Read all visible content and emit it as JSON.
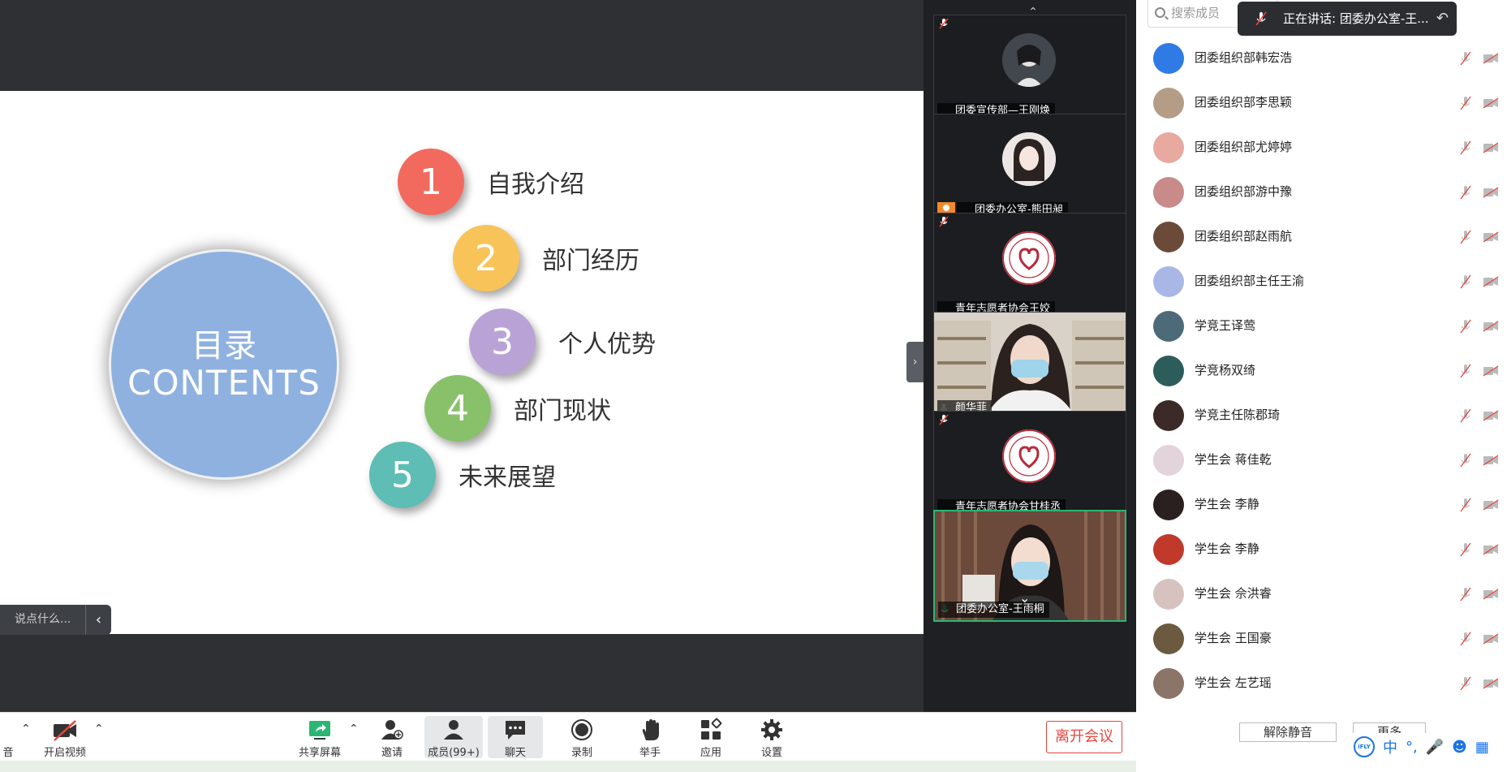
{
  "slide": {
    "center_line1": "目录",
    "center_line2": "CONTENTS",
    "items": [
      {
        "num": "1",
        "label": "自我介绍",
        "color": "#f26a5e"
      },
      {
        "num": "2",
        "label": "部门经历",
        "color": "#f8c45a"
      },
      {
        "num": "3",
        "label": "个人优势",
        "color": "#b9a3d6"
      },
      {
        "num": "4",
        "label": "部门现状",
        "color": "#88c16a"
      },
      {
        "num": "5",
        "label": "未来展望",
        "color": "#5ebdb5"
      }
    ]
  },
  "say_box": {
    "placeholder": "说点什么..."
  },
  "strip": {
    "tiles": [
      {
        "name": "团委宣传部—王刚焕"
      },
      {
        "name": "团委办公室-熊田昶"
      },
      {
        "name": "青年志愿者协会王姣"
      },
      {
        "name": "颜华菲"
      },
      {
        "name": "青年志愿者协会甘桂丞"
      },
      {
        "name": "团委办公室-王雨桐"
      }
    ]
  },
  "panel": {
    "search_placeholder": "搜索成员",
    "speaking": "正在讲话: 团委办公室-王...",
    "members": [
      {
        "name": "团委组织部韩宏浩",
        "color": "#2f7ae5"
      },
      {
        "name": "团委组织部李思颖",
        "color": "#b59c86"
      },
      {
        "name": "团委组织部尤婷婷",
        "color": "#e7a9a0"
      },
      {
        "name": "团委组织部游中豫",
        "color": "#c98a8a"
      },
      {
        "name": "团委组织部赵雨航",
        "color": "#6b4a3a"
      },
      {
        "name": "团委组织部主任王渝",
        "color": "#a9b7e6"
      },
      {
        "name": "学竞王译莺",
        "color": "#4d6a78"
      },
      {
        "name": "学竞杨双绮",
        "color": "#2c5d5a"
      },
      {
        "name": "学竞主任陈郡琦",
        "color": "#3b2a28"
      },
      {
        "name": "学生会 蒋佳乾",
        "color": "#e3d3da"
      },
      {
        "name": "学生会 李静",
        "color": "#2b2020"
      },
      {
        "name": "学生会 李静",
        "color": "#c0392b"
      },
      {
        "name": "学生会 佘洪睿",
        "color": "#d8c2c0"
      },
      {
        "name": "学生会 王国豪",
        "color": "#6b5a3f"
      },
      {
        "name": "学生会 左艺瑶",
        "color": "#8b7468"
      }
    ],
    "unmute_all": "解除静音",
    "more": "更多"
  },
  "ime": {
    "logo": "iFLY",
    "mode": "中"
  },
  "toolbar": {
    "mute_tail": "音",
    "video": "开启视频",
    "share": "共享屏幕",
    "invite": "邀请",
    "members": "成员(99+)",
    "chat": "聊天",
    "record": "录制",
    "raise": "举手",
    "apps": "应用",
    "settings": "设置",
    "leave": "离开会议"
  },
  "colors": {
    "leave": "#e8453c",
    "active_border": "#2bb673",
    "share_green": "#2bb673"
  }
}
